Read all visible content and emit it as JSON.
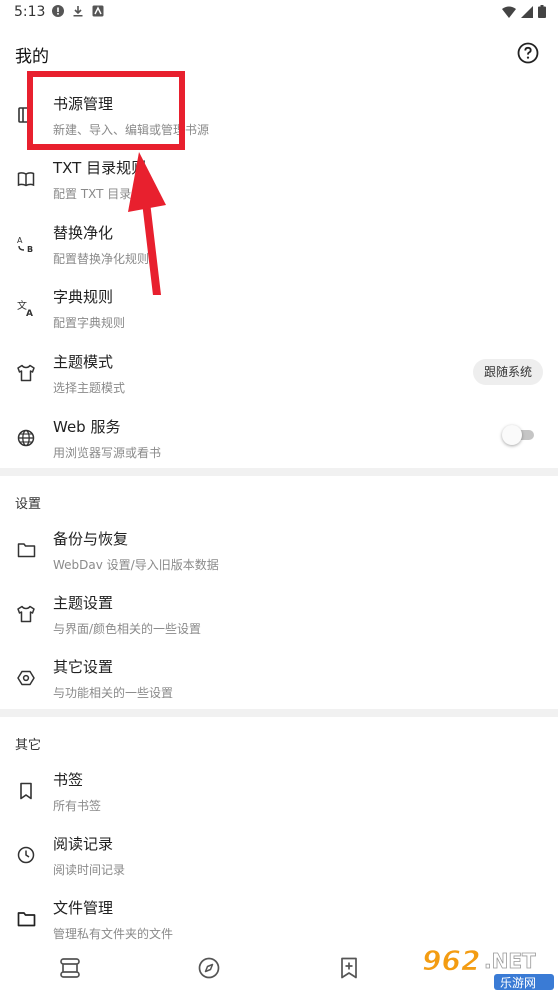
{
  "status_bar": {
    "time": "5:13"
  },
  "header": {
    "title": "我的"
  },
  "menu": [
    {
      "title": "书源管理",
      "subtitle": "新建、导入、编辑或管理书源",
      "icon": "book-icon"
    },
    {
      "title": "TXT 目录规则",
      "subtitle": "配置 TXT 目录规则",
      "icon": "open-book-icon"
    },
    {
      "title": "替换净化",
      "subtitle": "配置替换净化规则",
      "icon": "replace-icon"
    },
    {
      "title": "字典规则",
      "subtitle": "配置字典规则",
      "icon": "translate-icon"
    },
    {
      "title": "主题模式",
      "subtitle": "选择主题模式",
      "icon": "shirt-icon",
      "chip": "跟随系统"
    },
    {
      "title": "Web 服务",
      "subtitle": "用浏览器写源或看书",
      "icon": "globe-icon",
      "toggle": "off"
    }
  ],
  "settings": {
    "title": "设置",
    "items": [
      {
        "title": "备份与恢复",
        "subtitle": "WebDav 设置/导入旧版本数据",
        "icon": "folder-icon"
      },
      {
        "title": "主题设置",
        "subtitle": "与界面/颜色相关的一些设置",
        "icon": "shirt-icon"
      },
      {
        "title": "其它设置",
        "subtitle": "与功能相关的一些设置",
        "icon": "hexagon-settings-icon"
      }
    ]
  },
  "other": {
    "title": "其它",
    "items": [
      {
        "title": "书签",
        "subtitle": "所有书签",
        "icon": "bookmark-icon"
      },
      {
        "title": "阅读记录",
        "subtitle": "阅读时间记录",
        "icon": "clock-icon"
      },
      {
        "title": "文件管理",
        "subtitle": "管理私有文件夹的文件",
        "icon": "folder-icon"
      }
    ]
  },
  "bottom_nav": [
    "bookshelf-icon",
    "compass-icon",
    "rss-bookmark-icon"
  ],
  "watermark": {
    "number": "962",
    "suffix": ".NET",
    "cn": "乐游网"
  },
  "colors": {
    "annotation": "#e8202e",
    "chip_bg": "#eeeeee",
    "divider": "#f1f1f1"
  }
}
